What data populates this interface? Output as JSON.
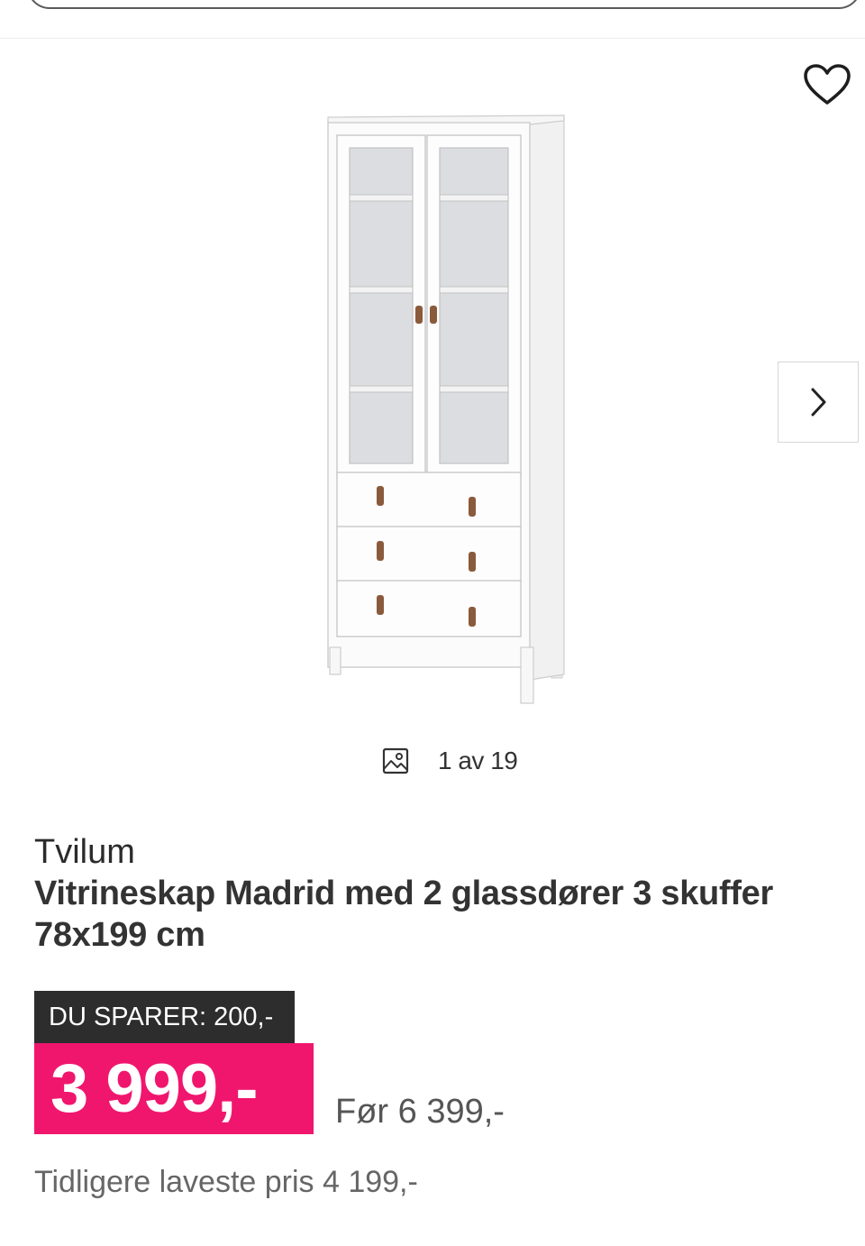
{
  "gallery": {
    "counter_text": "1 av 19",
    "image_alt": "Vitrineskap Madrid hvit"
  },
  "icons": {
    "favorite": "heart-outline-icon",
    "next": "chevron-right-icon",
    "gallery": "image-icon"
  },
  "product": {
    "brand": "Tvilum",
    "title": "Vitrineskap Madrid med 2 glassdører 3 skuffer 78x199 cm"
  },
  "pricing": {
    "savings_label": "DU SPARER: 200,-",
    "price": "3 999,-",
    "old_price": "Før 6 399,-",
    "lowest_price": "Tidligere laveste pris 4 199,-"
  },
  "colors": {
    "price_bg": "#f0166e",
    "badge_bg": "#2d2d2d"
  }
}
